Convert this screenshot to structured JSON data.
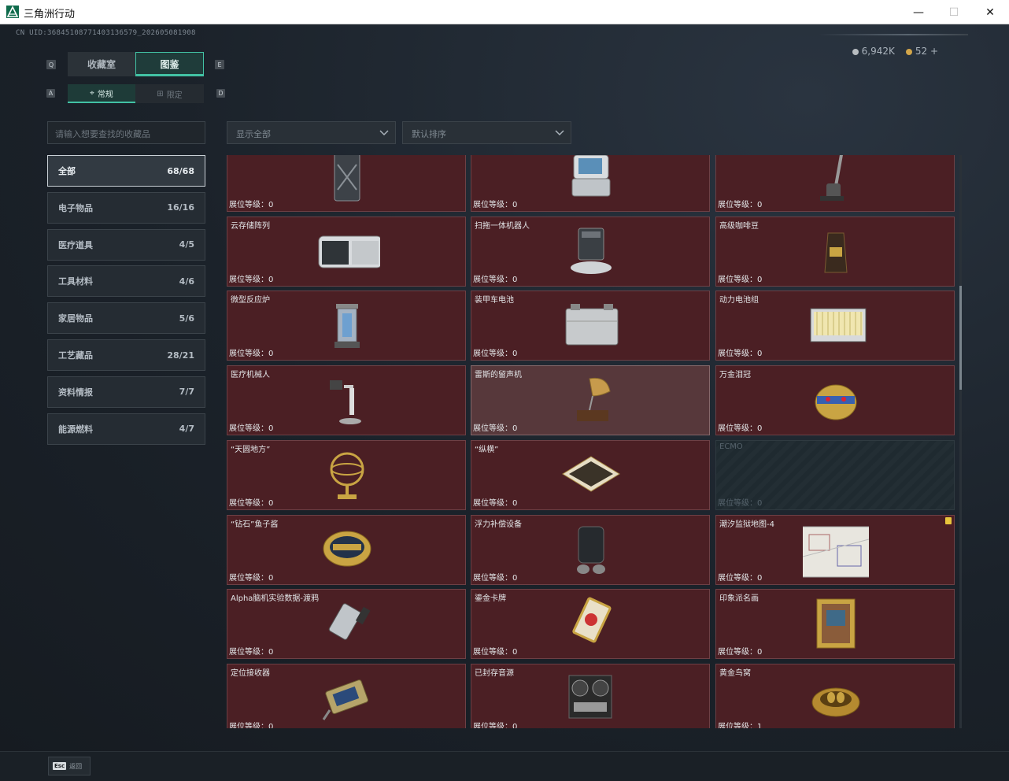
{
  "window": {
    "title": "三角洲行动",
    "minimize": "—",
    "maximize": "☐",
    "close": "✕"
  },
  "header": {
    "uid": "CN UID:36845108771403136579_202605081908",
    "currency": [
      {
        "value": "6,942K",
        "color": "#b7bcc0"
      },
      {
        "value": "52 +",
        "color": "#d3a64a"
      }
    ]
  },
  "tabs": {
    "left_key": "Q",
    "right_key": "E",
    "items": [
      {
        "label": "收藏室",
        "active": false
      },
      {
        "label": "图鉴",
        "active": true
      }
    ]
  },
  "subtabs": {
    "left_key": "A",
    "right_key": "D",
    "items": [
      {
        "label": "常规",
        "active": true
      },
      {
        "label": "限定",
        "active": false
      }
    ]
  },
  "search": {
    "placeholder": "请输入想要查找的收藏品"
  },
  "filters": {
    "display": "显示全部",
    "sort": "默认排序"
  },
  "categories": [
    {
      "label": "全部",
      "count": "68/68",
      "active": true
    },
    {
      "label": "电子物品",
      "count": "16/16",
      "active": false
    },
    {
      "label": "医疗道具",
      "count": "4/5",
      "active": false
    },
    {
      "label": "工具材料",
      "count": "4/6",
      "active": false
    },
    {
      "label": "家居物品",
      "count": "5/6",
      "active": false
    },
    {
      "label": "工艺藏品",
      "count": "28/21",
      "active": false
    },
    {
      "label": "资料情报",
      "count": "7/7",
      "active": false
    },
    {
      "label": "能源燃料",
      "count": "4/7",
      "active": false
    }
  ],
  "items": [
    {
      "name": "",
      "level": "展位等级：0",
      "icon": "jerrycan-icon"
    },
    {
      "name": "",
      "level": "展位等级：0",
      "icon": "device-icon"
    },
    {
      "name": "",
      "level": "展位等级：0",
      "icon": "vacuum-icon"
    },
    {
      "name": "云存储阵列",
      "level": "展位等级：0",
      "icon": "storage-array-icon"
    },
    {
      "name": "扫拖一体机器人",
      "level": "展位等级：0",
      "icon": "robot-vacuum-icon"
    },
    {
      "name": "高级咖啡豆",
      "level": "展位等级：0",
      "icon": "coffee-bag-icon"
    },
    {
      "name": "微型反应炉",
      "level": "展位等级：0",
      "icon": "reactor-icon"
    },
    {
      "name": "装甲车电池",
      "level": "展位等级：0",
      "icon": "battery-icon"
    },
    {
      "name": "动力电池组",
      "level": "展位等级：0",
      "icon": "battery-pack-icon"
    },
    {
      "name": "医疗机械人",
      "level": "展位等级：0",
      "icon": "medical-robot-icon"
    },
    {
      "name": "雷斯的留声机",
      "level": "展位等级：0",
      "icon": "gramophone-icon",
      "highlight": true
    },
    {
      "name": "万金泪冠",
      "level": "展位等级：0",
      "icon": "jeweled-egg-icon"
    },
    {
      "name": "“天圆地方”",
      "level": "展位等级：0",
      "icon": "armillary-icon"
    },
    {
      "name": "“纵横”",
      "level": "展位等级：0",
      "icon": "chessboard-icon"
    },
    {
      "name": "ECMO",
      "level": "展位等级：0",
      "icon": "locked-item-icon",
      "locked": true
    },
    {
      "name": "“钻石”鱼子酱",
      "level": "展位等级：0",
      "icon": "caviar-tin-icon"
    },
    {
      "name": "浮力补偿设备",
      "level": "展位等级：0",
      "icon": "bcd-icon"
    },
    {
      "name": "潮汐监狱地图-4",
      "level": "展位等级：0",
      "icon": "map-icon",
      "badge": true
    },
    {
      "name": "Alpha脑机实验数据-渡鸦",
      "level": "展位等级：0",
      "icon": "data-drive-icon"
    },
    {
      "name": "鎏金卡牌",
      "level": "展位等级：0",
      "icon": "gold-card-icon"
    },
    {
      "name": "印象派名画",
      "level": "展位等级：0",
      "icon": "painting-icon"
    },
    {
      "name": "定位接收器",
      "level": "展位等级：0",
      "icon": "receiver-icon"
    },
    {
      "name": "已封存音源",
      "level": "展位等级：0",
      "icon": "reel-recorder-icon"
    },
    {
      "name": "黄金鸟窝",
      "level": "展位等级：1",
      "icon": "golden-nest-icon"
    }
  ],
  "bottom": {
    "esc_key": "Esc",
    "back_label": "返回"
  }
}
